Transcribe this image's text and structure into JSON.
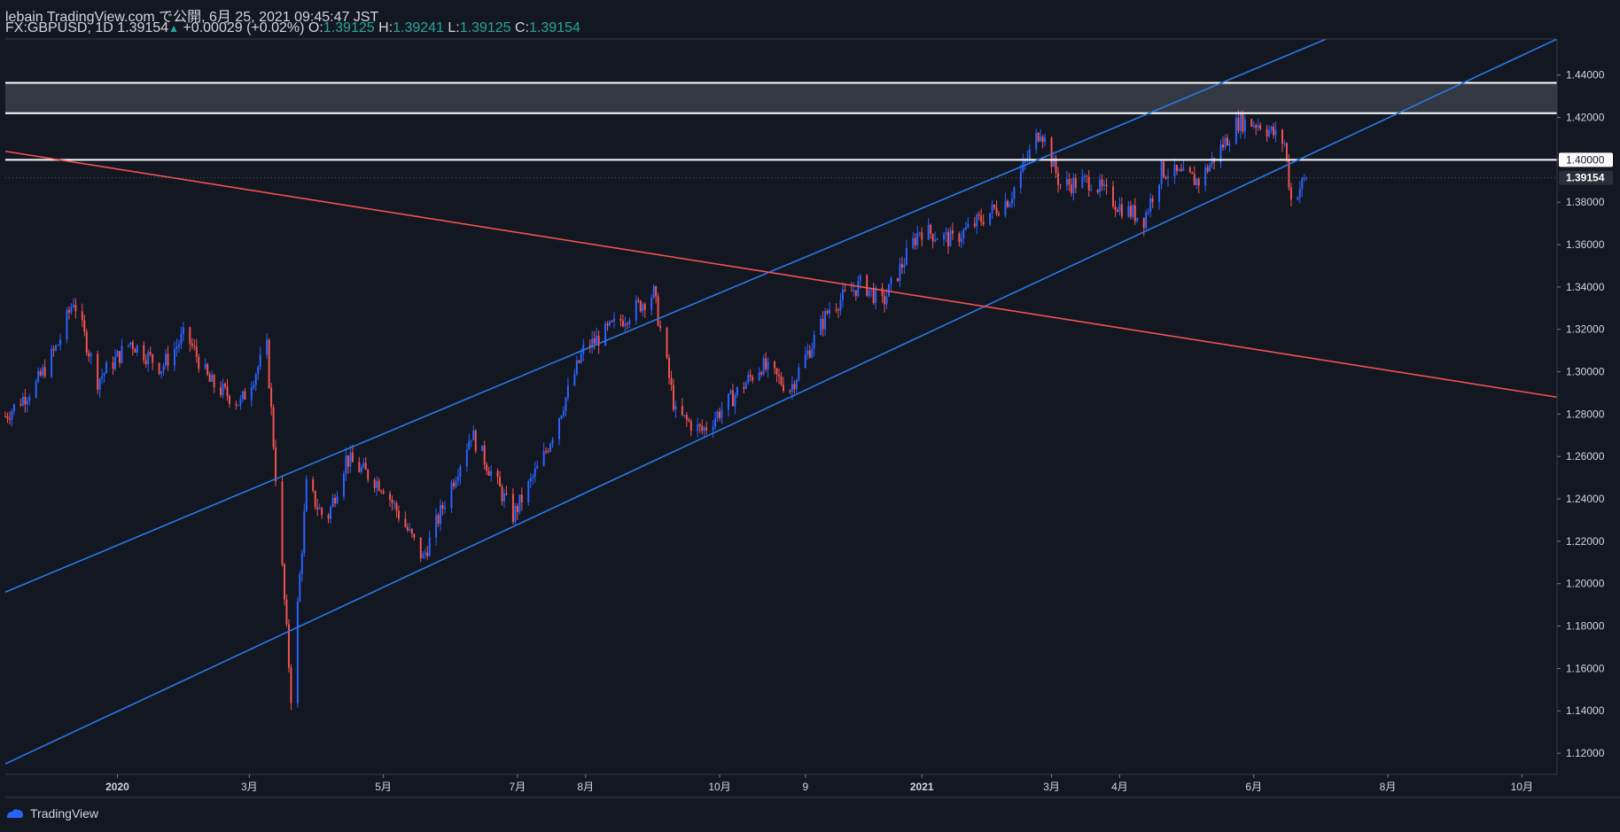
{
  "header": {
    "line1": "lebain TradingView.com で公開, 6月 25, 2021 09:45:47 JST",
    "symbol": "FX:GBPUSD, 1D",
    "last": "1.39154",
    "change": "+0.00029 (+0.02%)",
    "o_label": "O:",
    "o_value": "1.39125",
    "h_label": "H:",
    "h_value": "1.39241",
    "l_label": "L:",
    "l_value": "1.39125",
    "c_label": "C:",
    "c_value": "1.39154"
  },
  "footer": {
    "brand": "TradingView"
  },
  "colors": {
    "background": "#131722",
    "up": "#2962ff",
    "down": "#ef5350",
    "channel": "#2979e6",
    "trend": "#ef5350",
    "level": "#ffffff",
    "zone": "#3a3e48"
  },
  "chart_data": {
    "type": "candlestick",
    "symbol": "FX:GBPUSD",
    "interval": "1D",
    "ylim": [
      1.11,
      1.457
    ],
    "y_ticks": [
      "1.44000",
      "1.42000",
      "1.40000",
      "1.38000",
      "1.36000",
      "1.34000",
      "1.32000",
      "1.30000",
      "1.28000",
      "1.26000",
      "1.24000",
      "1.22000",
      "1.20000",
      "1.18000",
      "1.16000",
      "1.14000",
      "1.12000"
    ],
    "x_ticks": [
      {
        "label": "2020",
        "date": "2020-01-01",
        "bold": true
      },
      {
        "label": "3月",
        "date": "2020-03-01"
      },
      {
        "label": "5月",
        "date": "2020-05-01"
      },
      {
        "label": "7月",
        "date": "2020-07-01"
      },
      {
        "label": "8月",
        "date": "2020-08-01"
      },
      {
        "label": "10月",
        "date": "2020-10-01"
      },
      {
        "label": "9",
        "date": "2020-11-09"
      },
      {
        "label": "2021",
        "date": "2021-01-01",
        "bold": true
      },
      {
        "label": "3月",
        "date": "2021-03-01"
      },
      {
        "label": "4月",
        "date": "2021-04-01"
      },
      {
        "label": "6月",
        "date": "2021-06-01"
      },
      {
        "label": "8月",
        "date": "2021-08-01"
      },
      {
        "label": "10月",
        "date": "2021-10-01"
      }
    ],
    "x_range": [
      "2019-11-11",
      "2021-10-17"
    ],
    "price_keypoints": [
      [
        "2019-11-11",
        1.279
      ],
      [
        "2019-11-25",
        1.294
      ],
      [
        "2019-12-05",
        1.313
      ],
      [
        "2019-12-12",
        1.334
      ],
      [
        "2019-12-23",
        1.296
      ],
      [
        "2020-01-07",
        1.314
      ],
      [
        "2020-01-21",
        1.302
      ],
      [
        "2020-02-01",
        1.318
      ],
      [
        "2020-02-12",
        1.295
      ],
      [
        "2020-02-26",
        1.285
      ],
      [
        "2020-03-09",
        1.311
      ],
      [
        "2020-03-20",
        1.147
      ],
      [
        "2020-03-27",
        1.246
      ],
      [
        "2020-04-05",
        1.229
      ],
      [
        "2020-04-14",
        1.259
      ],
      [
        "2020-05-01",
        1.246
      ],
      [
        "2020-05-19",
        1.212
      ],
      [
        "2020-06-10",
        1.271
      ],
      [
        "2020-06-29",
        1.232
      ],
      [
        "2020-07-13",
        1.26
      ],
      [
        "2020-07-31",
        1.31
      ],
      [
        "2020-09-01",
        1.337
      ],
      [
        "2020-09-11",
        1.28
      ],
      [
        "2020-09-23",
        1.272
      ],
      [
        "2020-10-20",
        1.303
      ],
      [
        "2020-11-02",
        1.292
      ],
      [
        "2020-11-20",
        1.33
      ],
      [
        "2020-12-05",
        1.342
      ],
      [
        "2020-12-14",
        1.332
      ],
      [
        "2020-12-31",
        1.367
      ],
      [
        "2021-01-15",
        1.362
      ],
      [
        "2021-02-10",
        1.382
      ],
      [
        "2021-02-24",
        1.415
      ],
      [
        "2021-03-05",
        1.388
      ],
      [
        "2021-03-19",
        1.39
      ],
      [
        "2021-04-01",
        1.378
      ],
      [
        "2021-04-12",
        1.372
      ],
      [
        "2021-04-20",
        1.395
      ],
      [
        "2021-05-07",
        1.39
      ],
      [
        "2021-05-25",
        1.418
      ],
      [
        "2021-06-04",
        1.417
      ],
      [
        "2021-06-15",
        1.408
      ],
      [
        "2021-06-18",
        1.381
      ],
      [
        "2021-06-25",
        1.39154
      ]
    ],
    "horizontal_levels": [
      {
        "price": 1.4363
      },
      {
        "price": 1.422
      },
      {
        "price": 1.4,
        "label": "1.40000"
      }
    ],
    "zone": {
      "top": 1.4363,
      "bottom": 1.422
    },
    "last_price_label": "1.39154",
    "trendlines": [
      {
        "name": "channel-upper",
        "from": [
          "2019-11-11",
          1.196
        ],
        "to": [
          "2021-07-04",
          1.457
        ]
      },
      {
        "name": "channel-lower",
        "from": [
          "2019-11-11",
          1.115
        ],
        "to": [
          "2021-10-17",
          1.457
        ]
      },
      {
        "name": "red-trendline",
        "from": [
          "2019-11-11",
          1.404
        ],
        "to": [
          "2021-10-17",
          1.288
        ]
      }
    ]
  }
}
